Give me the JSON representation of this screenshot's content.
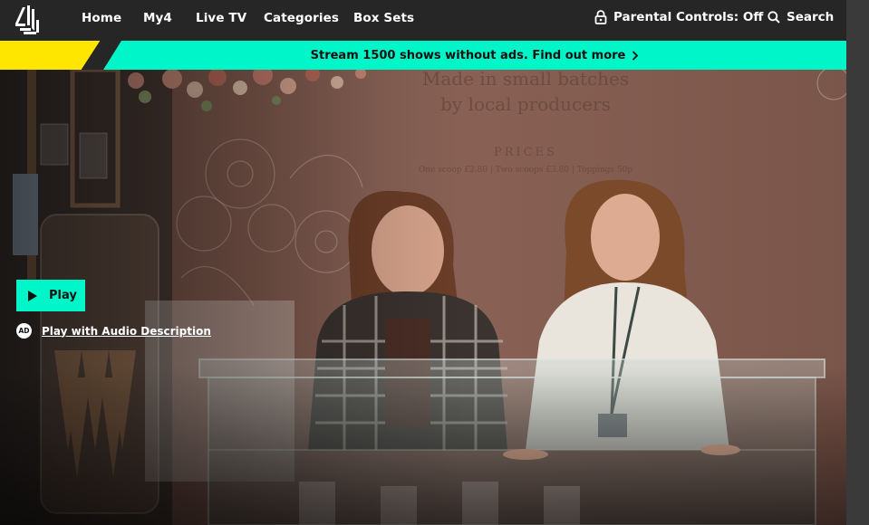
{
  "nav": {
    "logo_alt": "Channel 4",
    "links": [
      "Home",
      "My4",
      "Live TV",
      "Categories",
      "Box Sets"
    ],
    "parental_controls": "Parental Controls: Off",
    "search": "Search",
    "icons": {
      "logo": "channel-4-logo",
      "parental": "lock-icon",
      "search": "search-icon"
    }
  },
  "banner": {
    "text": "Stream 1500 shows without ads. Find out more",
    "icon": "chevron-right-icon"
  },
  "hero": {
    "wall_line1": "Made in small batches",
    "wall_line2": "by local producers",
    "prices_heading": "PRICES",
    "prices_detail": "One scoop £2.80 | Two scoops £3.80 | Toppings 50p"
  },
  "player": {
    "play_label": "Play",
    "ad_badge": "AD",
    "audio_description_label": "Play with Audio Description"
  },
  "colors": {
    "accent_teal": "#00f5c8",
    "accent_yellow": "#ffe600",
    "nav_bg": "#262626"
  }
}
